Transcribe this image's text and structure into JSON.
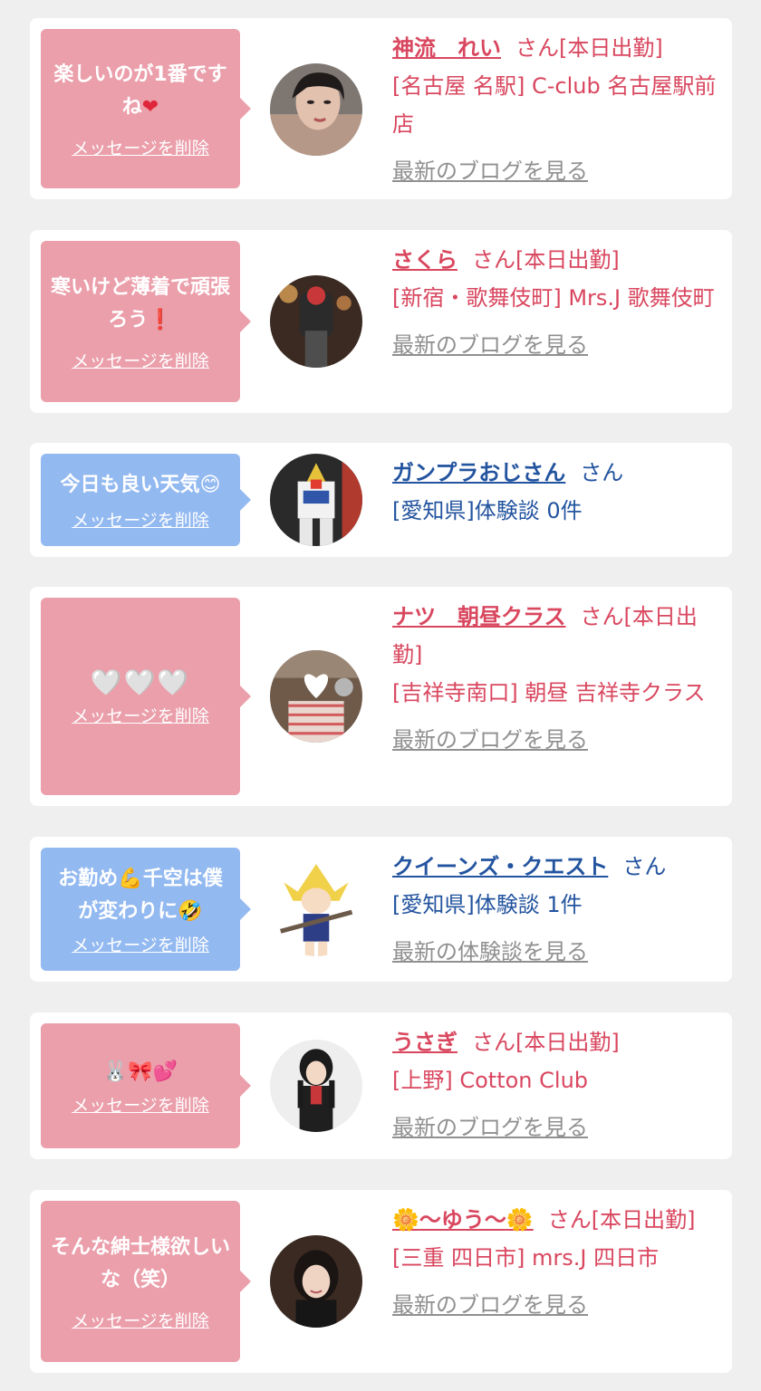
{
  "cards": [
    {
      "message": "楽しいのが1番ですね",
      "message_emoji": "❤",
      "delete_label": "メッセージを削除",
      "name": "神流　れい",
      "suffix": "さん[本日出勤]",
      "shop": "[名古屋 名駅] C-club 名古屋駅前店",
      "link": "最新のブログを見る"
    },
    {
      "message": "寒いけど薄着で頑張ろう",
      "message_emoji": "❗",
      "delete_label": "メッセージを削除",
      "name": "さくら",
      "suffix": "さん[本日出勤]",
      "shop": "[新宿・歌舞伎町] Mrs.J 歌舞伎町",
      "link": "最新のブログを見る"
    },
    {
      "message": "今日も良い天気",
      "message_emoji": "😊",
      "delete_label": "メッセージを削除",
      "name": "ガンプラおじさん",
      "suffix": "さん",
      "shop": "[愛知県]体験談 0件",
      "link": ""
    },
    {
      "message": "🤍🤍🤍",
      "delete_label": "メッセージを削除",
      "name": "ナツ　朝昼クラス",
      "suffix": "さん[本日出勤]",
      "shop": "[吉祥寺南口] 朝昼 吉祥寺クラス",
      "link": "最新のブログを見る"
    },
    {
      "message_pre": "お勤め",
      "message_emoji1": "💪",
      "message_mid": "千空は僕が変わりに",
      "message_emoji2": "🤣",
      "delete_label": "メッセージを削除",
      "name": "クイーンズ・クエスト",
      "suffix": "さん",
      "shop": "[愛知県]体験談 1件",
      "link": "最新の体験談を見る"
    },
    {
      "message": "🐰🎀💕",
      "delete_label": "メッセージを削除",
      "name": "うさぎ",
      "suffix": "さん[本日出勤]",
      "shop": "[上野] Cotton Club",
      "link": "最新のブログを見る"
    },
    {
      "message": "そんな紳士様欲しいな（笑）",
      "delete_label": "メッセージを削除",
      "name_emoji": "🌼",
      "name": "〜ゆう〜",
      "suffix": "さん[本日出勤]",
      "shop": "[三重 四日市] mrs.J 四日市",
      "link": "最新のブログを見る"
    }
  ]
}
